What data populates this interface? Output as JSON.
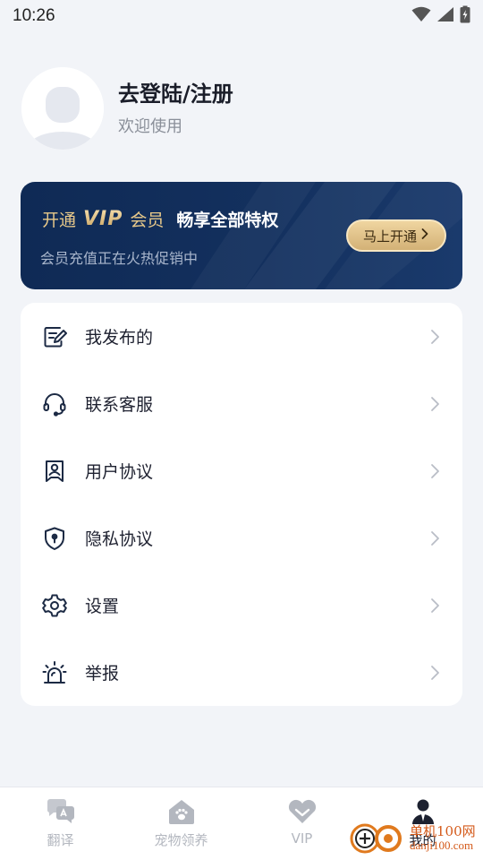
{
  "status_bar": {
    "time": "10:26",
    "icons": [
      "wifi-icon",
      "signal-icon",
      "battery-icon"
    ]
  },
  "profile": {
    "title": "去登陆/注册",
    "subtitle": "欢迎使用"
  },
  "vip_banner": {
    "prefix": "开通",
    "logo": "VIP",
    "member": "会员",
    "headline": "畅享全部特权",
    "subtitle": "会员充值正在火热促销中",
    "button_label": "马上开通"
  },
  "menu": {
    "items": [
      {
        "label": "我发布的",
        "icon": "edit-document-icon"
      },
      {
        "label": "联系客服",
        "icon": "headset-icon"
      },
      {
        "label": "用户协议",
        "icon": "user-badge-icon"
      },
      {
        "label": "隐私协议",
        "icon": "shield-lock-icon"
      },
      {
        "label": "设置",
        "icon": "settings-icon"
      },
      {
        "label": "举报",
        "icon": "alarm-icon"
      }
    ]
  },
  "tab_bar": {
    "tabs": [
      {
        "label": "翻译",
        "icon": "translate-icon",
        "active": false
      },
      {
        "label": "宠物领养",
        "icon": "pet-house-icon",
        "active": false
      },
      {
        "label": "VIP",
        "icon": "vip-heart-icon",
        "active": false
      },
      {
        "label": "我的",
        "icon": "user-icon",
        "active": true
      }
    ]
  },
  "watermark": {
    "line1": "单机100网",
    "line2": "danji100.com"
  },
  "colors": {
    "background": "#f2f4f8",
    "vip_navy": "#0f2a55",
    "vip_gold": "#e8c98a",
    "inactive_tab": "#b3b7bf",
    "icon_navy": "#1c2a44"
  }
}
